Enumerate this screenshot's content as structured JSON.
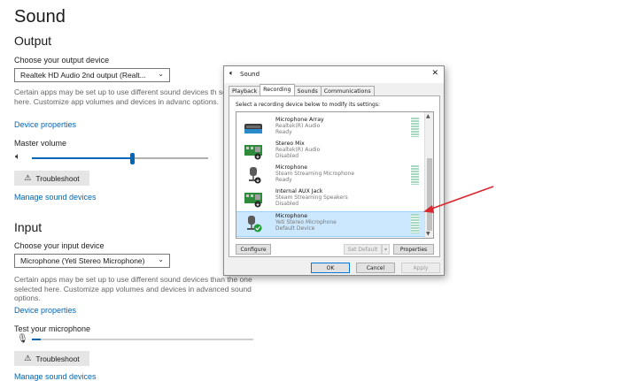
{
  "page": {
    "title": "Sound",
    "output": {
      "heading": "Output",
      "choose_label": "Choose your output device",
      "device": "Realtek HD Audio 2nd output (Realt...",
      "description": "Certain apps may be set up to use different sound devices th selected here. Customize app volumes and devices in advanc options.",
      "device_properties": "Device properties",
      "master_volume_label": "Master volume",
      "master_volume_level": 0.57,
      "troubleshoot": "Troubleshoot",
      "manage": "Manage sound devices"
    },
    "input": {
      "heading": "Input",
      "choose_label": "Choose your input device",
      "device": "Microphone (Yeti Stereo Microphone)",
      "description": "Certain apps may be set up to use different sound devices than the one selected here. Customize app volumes and devices in advanced sound options.",
      "device_properties": "Device properties",
      "test_label": "Test your microphone",
      "test_level": 0.04,
      "troubleshoot": "Troubleshoot",
      "manage": "Manage sound devices"
    }
  },
  "dialog": {
    "title": "Sound",
    "close": "✕",
    "tabs": [
      "Playback",
      "Recording",
      "Sounds",
      "Communications"
    ],
    "active_tab": "Recording",
    "instruction": "Select a recording device below to modify its settings:",
    "devices": [
      {
        "name": "Microphone Array",
        "sub": "Realtek(R) Audio",
        "status": "Ready",
        "icon": "mic-array-icon"
      },
      {
        "name": "Stereo Mix",
        "sub": "Realtek(R) Audio",
        "status": "Disabled",
        "icon": "stereo-mix-icon"
      },
      {
        "name": "Microphone",
        "sub": "Steam Streaming Microphone",
        "status": "Ready",
        "icon": "microphone-icon"
      },
      {
        "name": "Internal AUX Jack",
        "sub": "Steam Streaming Speakers",
        "status": "Disabled",
        "icon": "aux-jack-icon"
      },
      {
        "name": "Microphone",
        "sub": "Yeti Stereo Microphone",
        "status": "Default Device",
        "icon": "microphone-icon",
        "selected": true
      }
    ],
    "buttons": {
      "configure": "Configure",
      "set_default": "Set Default",
      "set_default_arrow": "▾",
      "properties": "Properties",
      "ok": "OK",
      "cancel": "Cancel",
      "apply": "Apply"
    }
  },
  "colors": {
    "link": "#0067b8",
    "accent": "#0067b8",
    "annotation_arrow": "#d9282f",
    "selected_row": "#cce8ff"
  }
}
